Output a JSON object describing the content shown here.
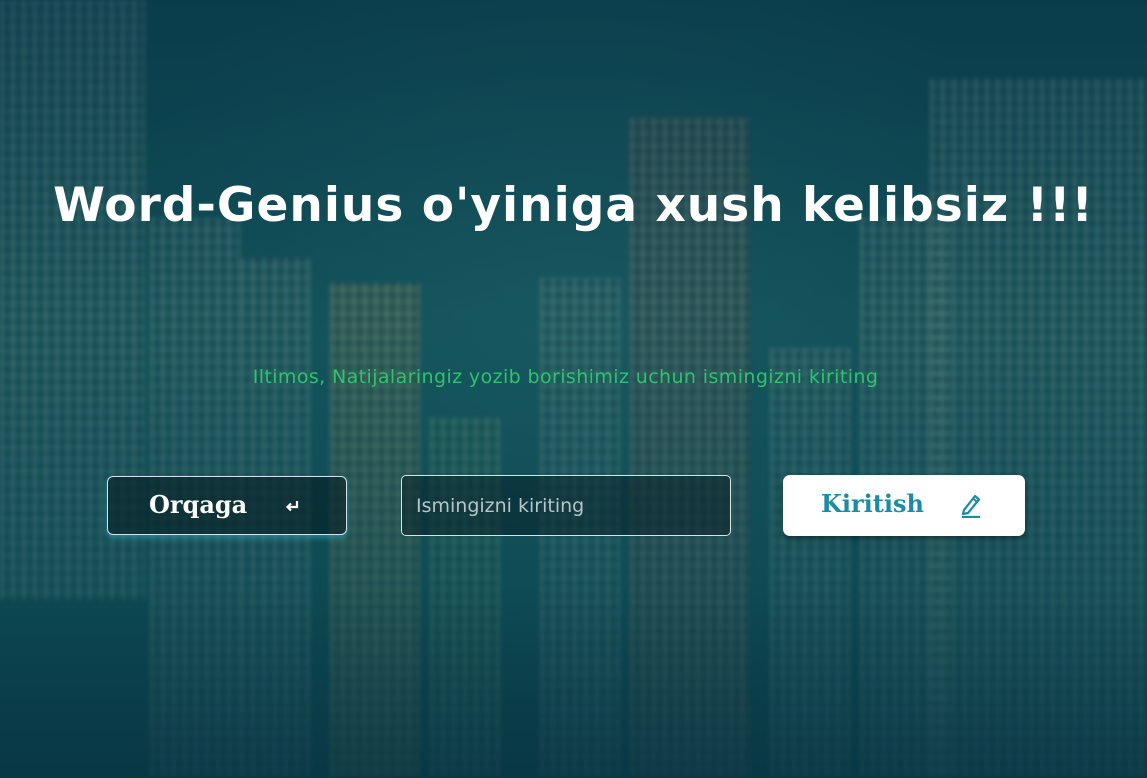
{
  "page": {
    "title": "Word-Genius o'yiniga xush kelibsiz !!!",
    "subtitle": "Iltimos, Natijalaringiz yozib borishimiz uchun ismingizni kiriting"
  },
  "form": {
    "back_label": "Orqaga",
    "back_icon": "return-arrow-icon",
    "name_placeholder": "Ismingizni kiriting",
    "name_value": "",
    "submit_label": "Kiritish",
    "submit_icon": "pencil-icon"
  },
  "colors": {
    "background": "#0e4650",
    "title": "#ffffff",
    "subtitle": "#2ec46b",
    "submit_text": "#1a8ca3",
    "back_glow": "#3cc8e6"
  }
}
